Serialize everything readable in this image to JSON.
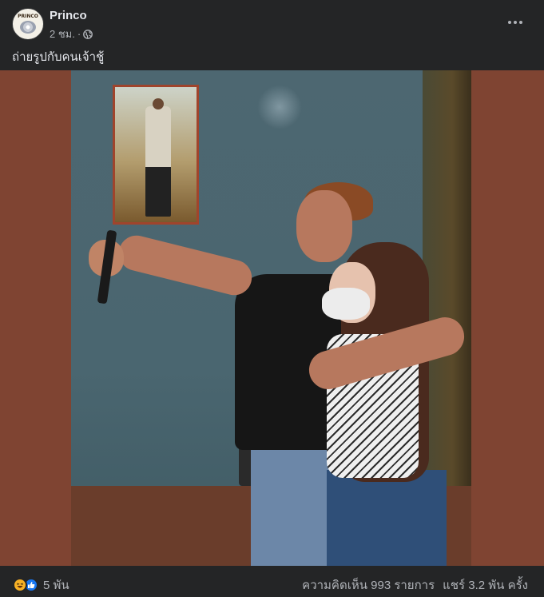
{
  "post": {
    "page_name": "Princo",
    "avatar_text": "PRINCO",
    "time": "2 ชม.",
    "separator": "·",
    "privacy_icon": "globe-icon",
    "more_icon": "more-horizontal-icon",
    "caption": "ถ่ายรูปกับคนเจ้าชู้"
  },
  "media": {
    "description_icon": "photo",
    "colors": {
      "backdrop": "#7f4432",
      "wall": "#4d6771"
    }
  },
  "footer": {
    "reaction_icons": [
      "haha-icon",
      "like-icon"
    ],
    "reaction_count": "5 พัน",
    "comments": "ความคิดเห็น 993 รายการ",
    "shares": "แชร์ 3.2 พัน ครั้ง"
  },
  "theme": {
    "background": "#242526",
    "text_primary": "#e4e6eb",
    "text_secondary": "#b0b3b8",
    "like_blue": "#1877f2",
    "haha_yellow": "#f7b125"
  }
}
